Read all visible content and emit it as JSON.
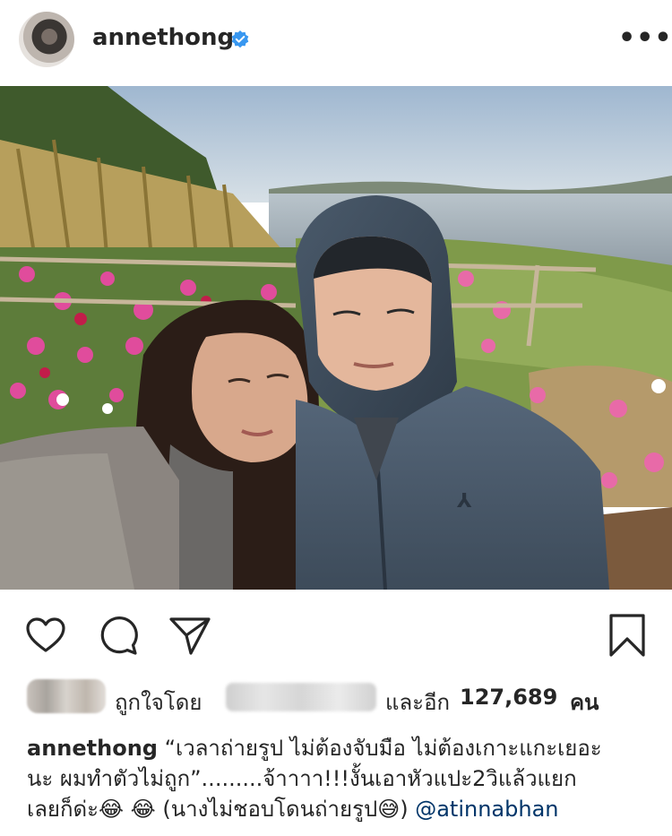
{
  "post": {
    "username": "annethong",
    "verified_icon": "verified-badge-icon",
    "more_icon": "more-options-icon",
    "more_label": "•••"
  },
  "actions": {
    "like_icon": "heart-icon",
    "comment_icon": "comment-icon",
    "share_icon": "send-icon",
    "save_icon": "bookmark-icon"
  },
  "likes": {
    "prefix": "ถูกใจโดย",
    "and_others": "และอีก",
    "count": "127,689",
    "unit": "คน"
  },
  "caption": {
    "username": "annethong",
    "line1": "“เวลาถ่ายรูป ไม่ต้องจับมือ ไม่ต้องเกาะแกะเยอะ",
    "line2": "นะ ผมทำตัวไม่ถูก”.........จ้าาาา!!!งั้นเอาหัวแปะ2วิแล้วแยก",
    "line3_start": "เลยก็ด่ะ😂 😂  (นางไม่ชอบโดนถ่ายรูป😅)",
    "mention": "@atinnabhan"
  },
  "colors": {
    "verified_blue": "#3897f0",
    "mention": "#003569",
    "text": "#262626"
  }
}
